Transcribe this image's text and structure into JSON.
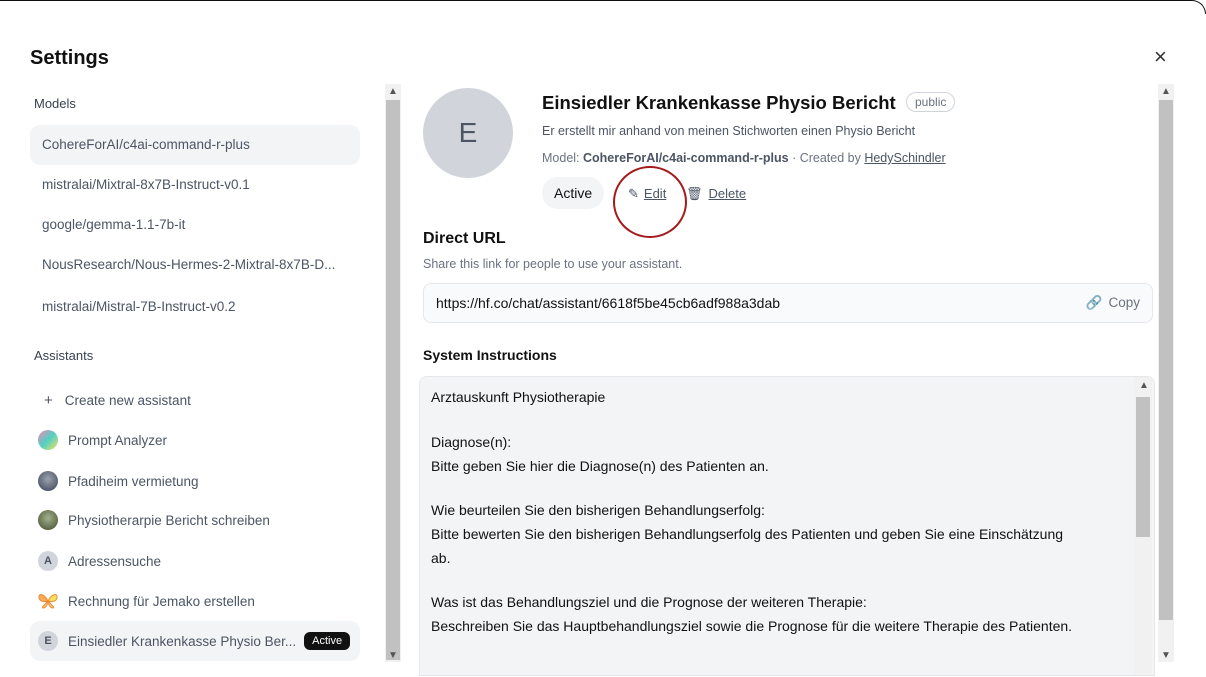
{
  "dialog": {
    "title": "Settings",
    "close_label": "×"
  },
  "sidebar": {
    "models_label": "Models",
    "models": [
      "CohereForAI/c4ai-command-r-plus",
      "mistralai/Mixtral-8x7B-Instruct-v0.1",
      "google/gemma-1.1-7b-it",
      "NousResearch/Nous-Hermes-2-Mixtral-8x7B-D...",
      "mistralai/Mistral-7B-Instruct-v0.2"
    ],
    "assistants_label": "Assistants",
    "create_label": "Create new assistant",
    "create_icon": "+",
    "assistants": [
      {
        "label": "Prompt Analyzer",
        "icon": "colorful-avatar",
        "color": "#4fd1c5"
      },
      {
        "label": "Pfadiheim vermietung",
        "icon": "photo-avatar",
        "color": "#4a5568"
      },
      {
        "label": "Physiotherarpie Bericht schreiben",
        "icon": "photo-avatar",
        "color": "#5a6b4a"
      },
      {
        "label": "Adressensuche",
        "icon": "letter-avatar",
        "letter": "A",
        "color": "#d1d5db"
      },
      {
        "label": "Rechnung für Jemako erstellen",
        "icon": "butterfly-avatar",
        "color": "#f6ad55"
      },
      {
        "label": "Einsiedler Krankenkasse Physio Ber...",
        "icon": "letter-avatar",
        "letter": "E",
        "color": "#d1d5db",
        "badge": "Active"
      }
    ]
  },
  "assistant": {
    "avatar_letter": "E",
    "name": "Einsiedler Krankenkasse Physio Bericht",
    "visibility": "public",
    "description": "Er erstellt mir anhand von meinen Stichworten einen Physio Bericht",
    "model_prefix": "Model: ",
    "model": "CohereForAI/c4ai-command-r-plus",
    "created_prefix": " · Created by ",
    "creator": "HedySchindler",
    "active_label": "Active",
    "edit_label": "Edit",
    "delete_label": "Delete"
  },
  "direct_url": {
    "heading": "Direct URL",
    "hint": "Share this link for people to use your assistant.",
    "url": "https://hf.co/chat/assistant/6618f5be45cb6adf988a3dab",
    "copy_label": "Copy"
  },
  "system_instructions": {
    "heading": "System Instructions",
    "lines": [
      "Arztauskunft Physiotherapie",
      "",
      "Diagnose(n):",
      "Bitte geben Sie hier die Diagnose(n) des Patienten an.",
      "",
      "Wie beurteilen Sie den bisherigen Behandlungserfolg:",
      "Bitte bewerten Sie den bisherigen Behandlungserfolg des Patienten und geben Sie eine Einschätzung",
      "ab.",
      "",
      "Was ist das Behandlungsziel und die Prognose der weiteren Therapie:",
      "Beschreiben Sie das Hauptbehandlungsziel sowie die Prognose für die weitere Therapie des Patienten."
    ]
  },
  "colors": {
    "accent_dark": "#111111",
    "annotation_circle": "#a31b1b"
  }
}
